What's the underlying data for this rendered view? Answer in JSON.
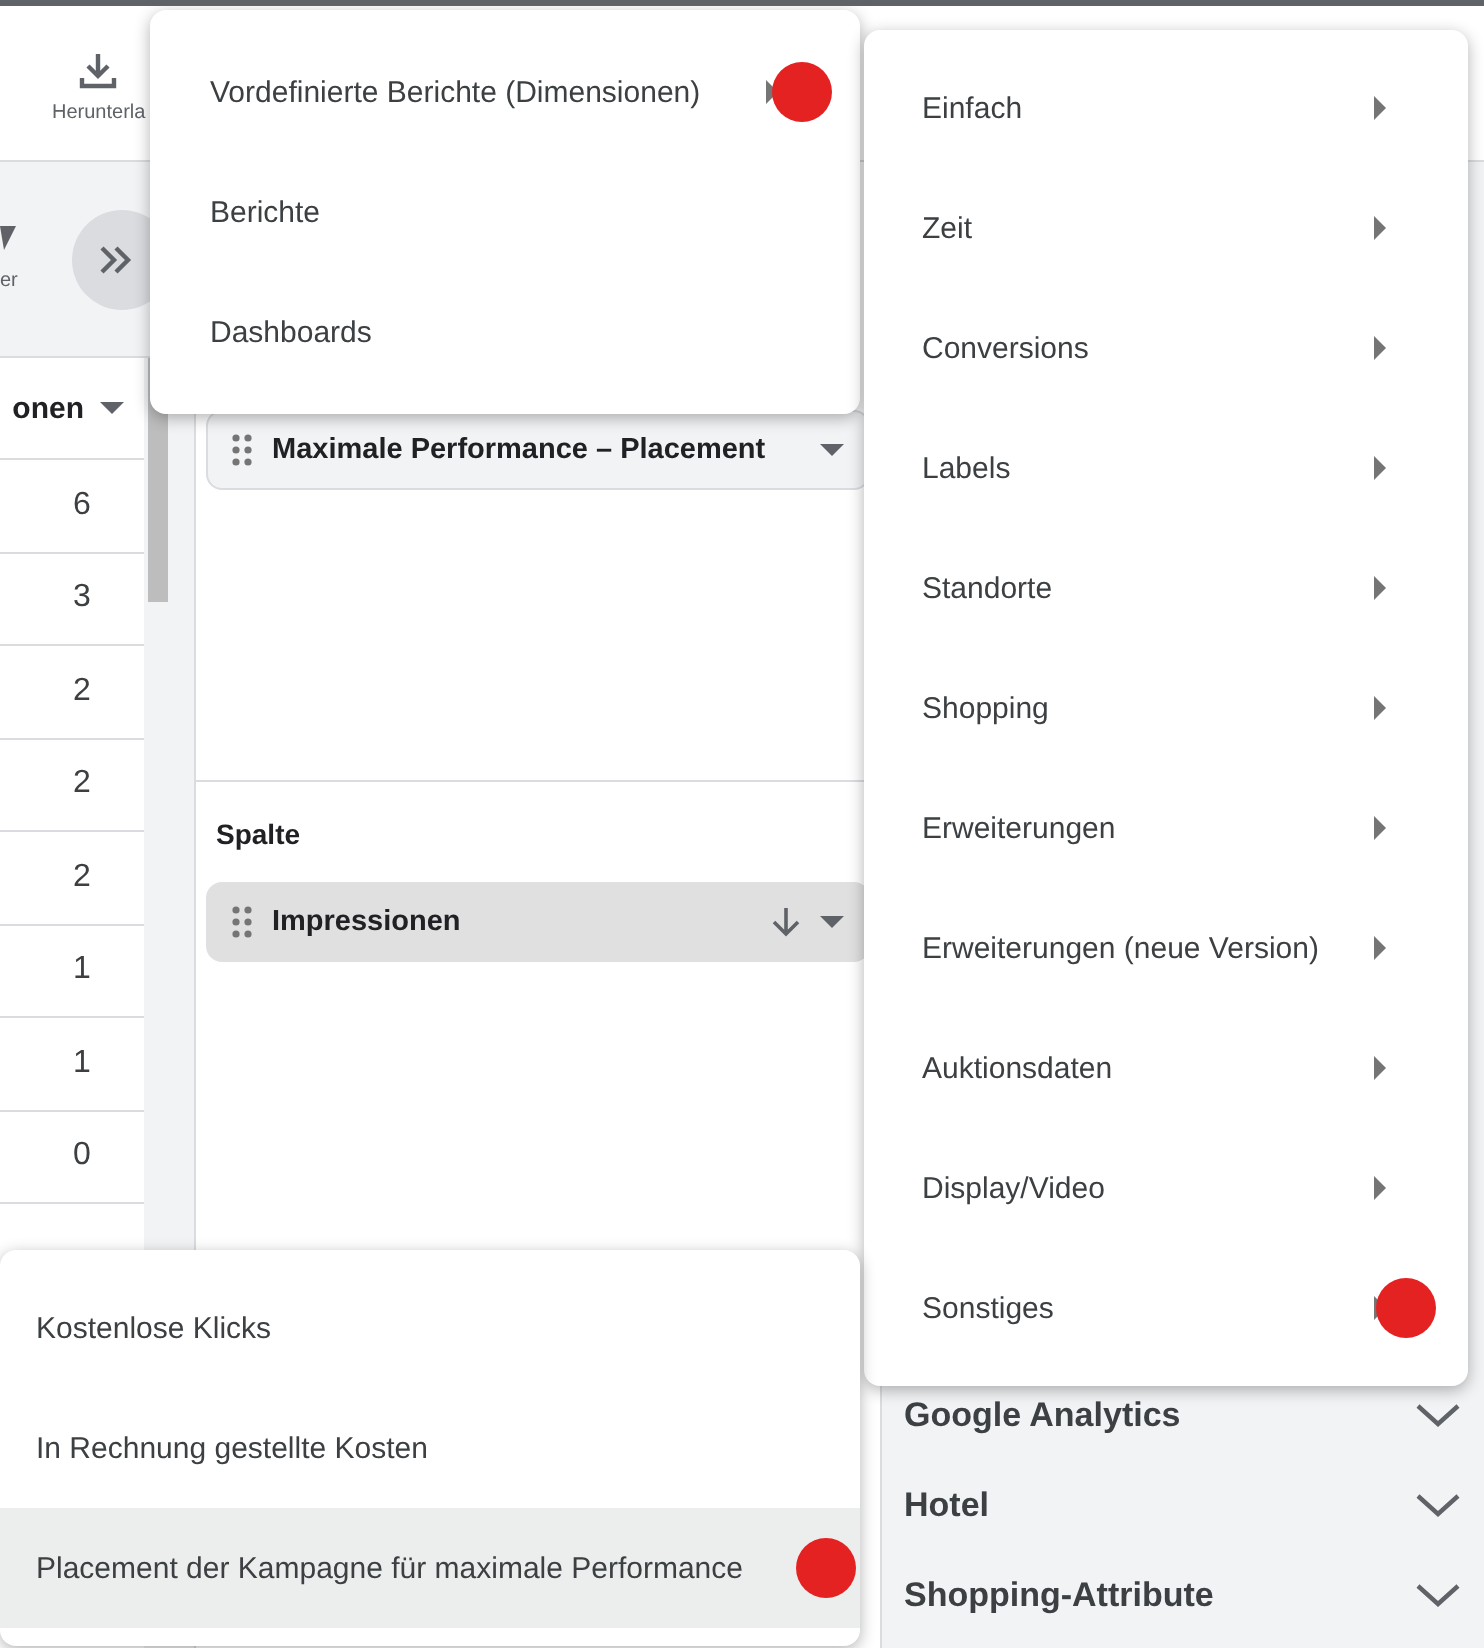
{
  "toolbar": {
    "download_label": "Herunterla",
    "filter_label": "er"
  },
  "table": {
    "header": "onen",
    "rows": [
      "6",
      "3",
      "2",
      "2",
      "2",
      "1",
      "1",
      "0"
    ]
  },
  "row_section": {
    "chip": "Maximale Performance – Placement"
  },
  "column_section": {
    "title": "Spalte",
    "chip": "Impressionen"
  },
  "accordion": [
    {
      "label": "Google Analytics",
      "expanded": false
    },
    {
      "label": "Hotel",
      "expanded": false
    },
    {
      "label": "Shopping-Attribute",
      "expanded": false
    }
  ],
  "menus": [
    {
      "items": [
        {
          "label": "Vordefinierte Berichte (Dimensionen)",
          "has_submenu": true,
          "marked": true,
          "highlighted": false
        },
        {
          "label": "Berichte",
          "has_submenu": false,
          "marked": false,
          "highlighted": false
        },
        {
          "label": "Dashboards",
          "has_submenu": false,
          "marked": false,
          "highlighted": false
        }
      ]
    },
    {
      "items": [
        {
          "label": "Einfach",
          "has_submenu": true,
          "marked": false,
          "highlighted": false
        },
        {
          "label": "Zeit",
          "has_submenu": true,
          "marked": false,
          "highlighted": false
        },
        {
          "label": "Conversions",
          "has_submenu": true,
          "marked": false,
          "highlighted": false
        },
        {
          "label": "Labels",
          "has_submenu": true,
          "marked": false,
          "highlighted": false
        },
        {
          "label": "Standorte",
          "has_submenu": true,
          "marked": false,
          "highlighted": false
        },
        {
          "label": "Shopping",
          "has_submenu": true,
          "marked": false,
          "highlighted": false
        },
        {
          "label": "Erweiterungen",
          "has_submenu": true,
          "marked": false,
          "highlighted": false
        },
        {
          "label": "Erweiterungen (neue Version)",
          "has_submenu": true,
          "marked": false,
          "highlighted": false
        },
        {
          "label": "Auktionsdaten",
          "has_submenu": true,
          "marked": false,
          "highlighted": false
        },
        {
          "label": "Display/Video",
          "has_submenu": true,
          "marked": false,
          "highlighted": false
        },
        {
          "label": "Sonstiges",
          "has_submenu": true,
          "marked": true,
          "highlighted": false
        }
      ]
    },
    {
      "items": [
        {
          "label": "Kostenlose Klicks",
          "has_submenu": false,
          "marked": false,
          "highlighted": false
        },
        {
          "label": "In Rechnung gestellte Kosten",
          "has_submenu": false,
          "marked": false,
          "highlighted": false
        },
        {
          "label": "Placement der Kampagne für maximale Performance",
          "has_submenu": false,
          "marked": true,
          "highlighted": true
        }
      ]
    }
  ]
}
